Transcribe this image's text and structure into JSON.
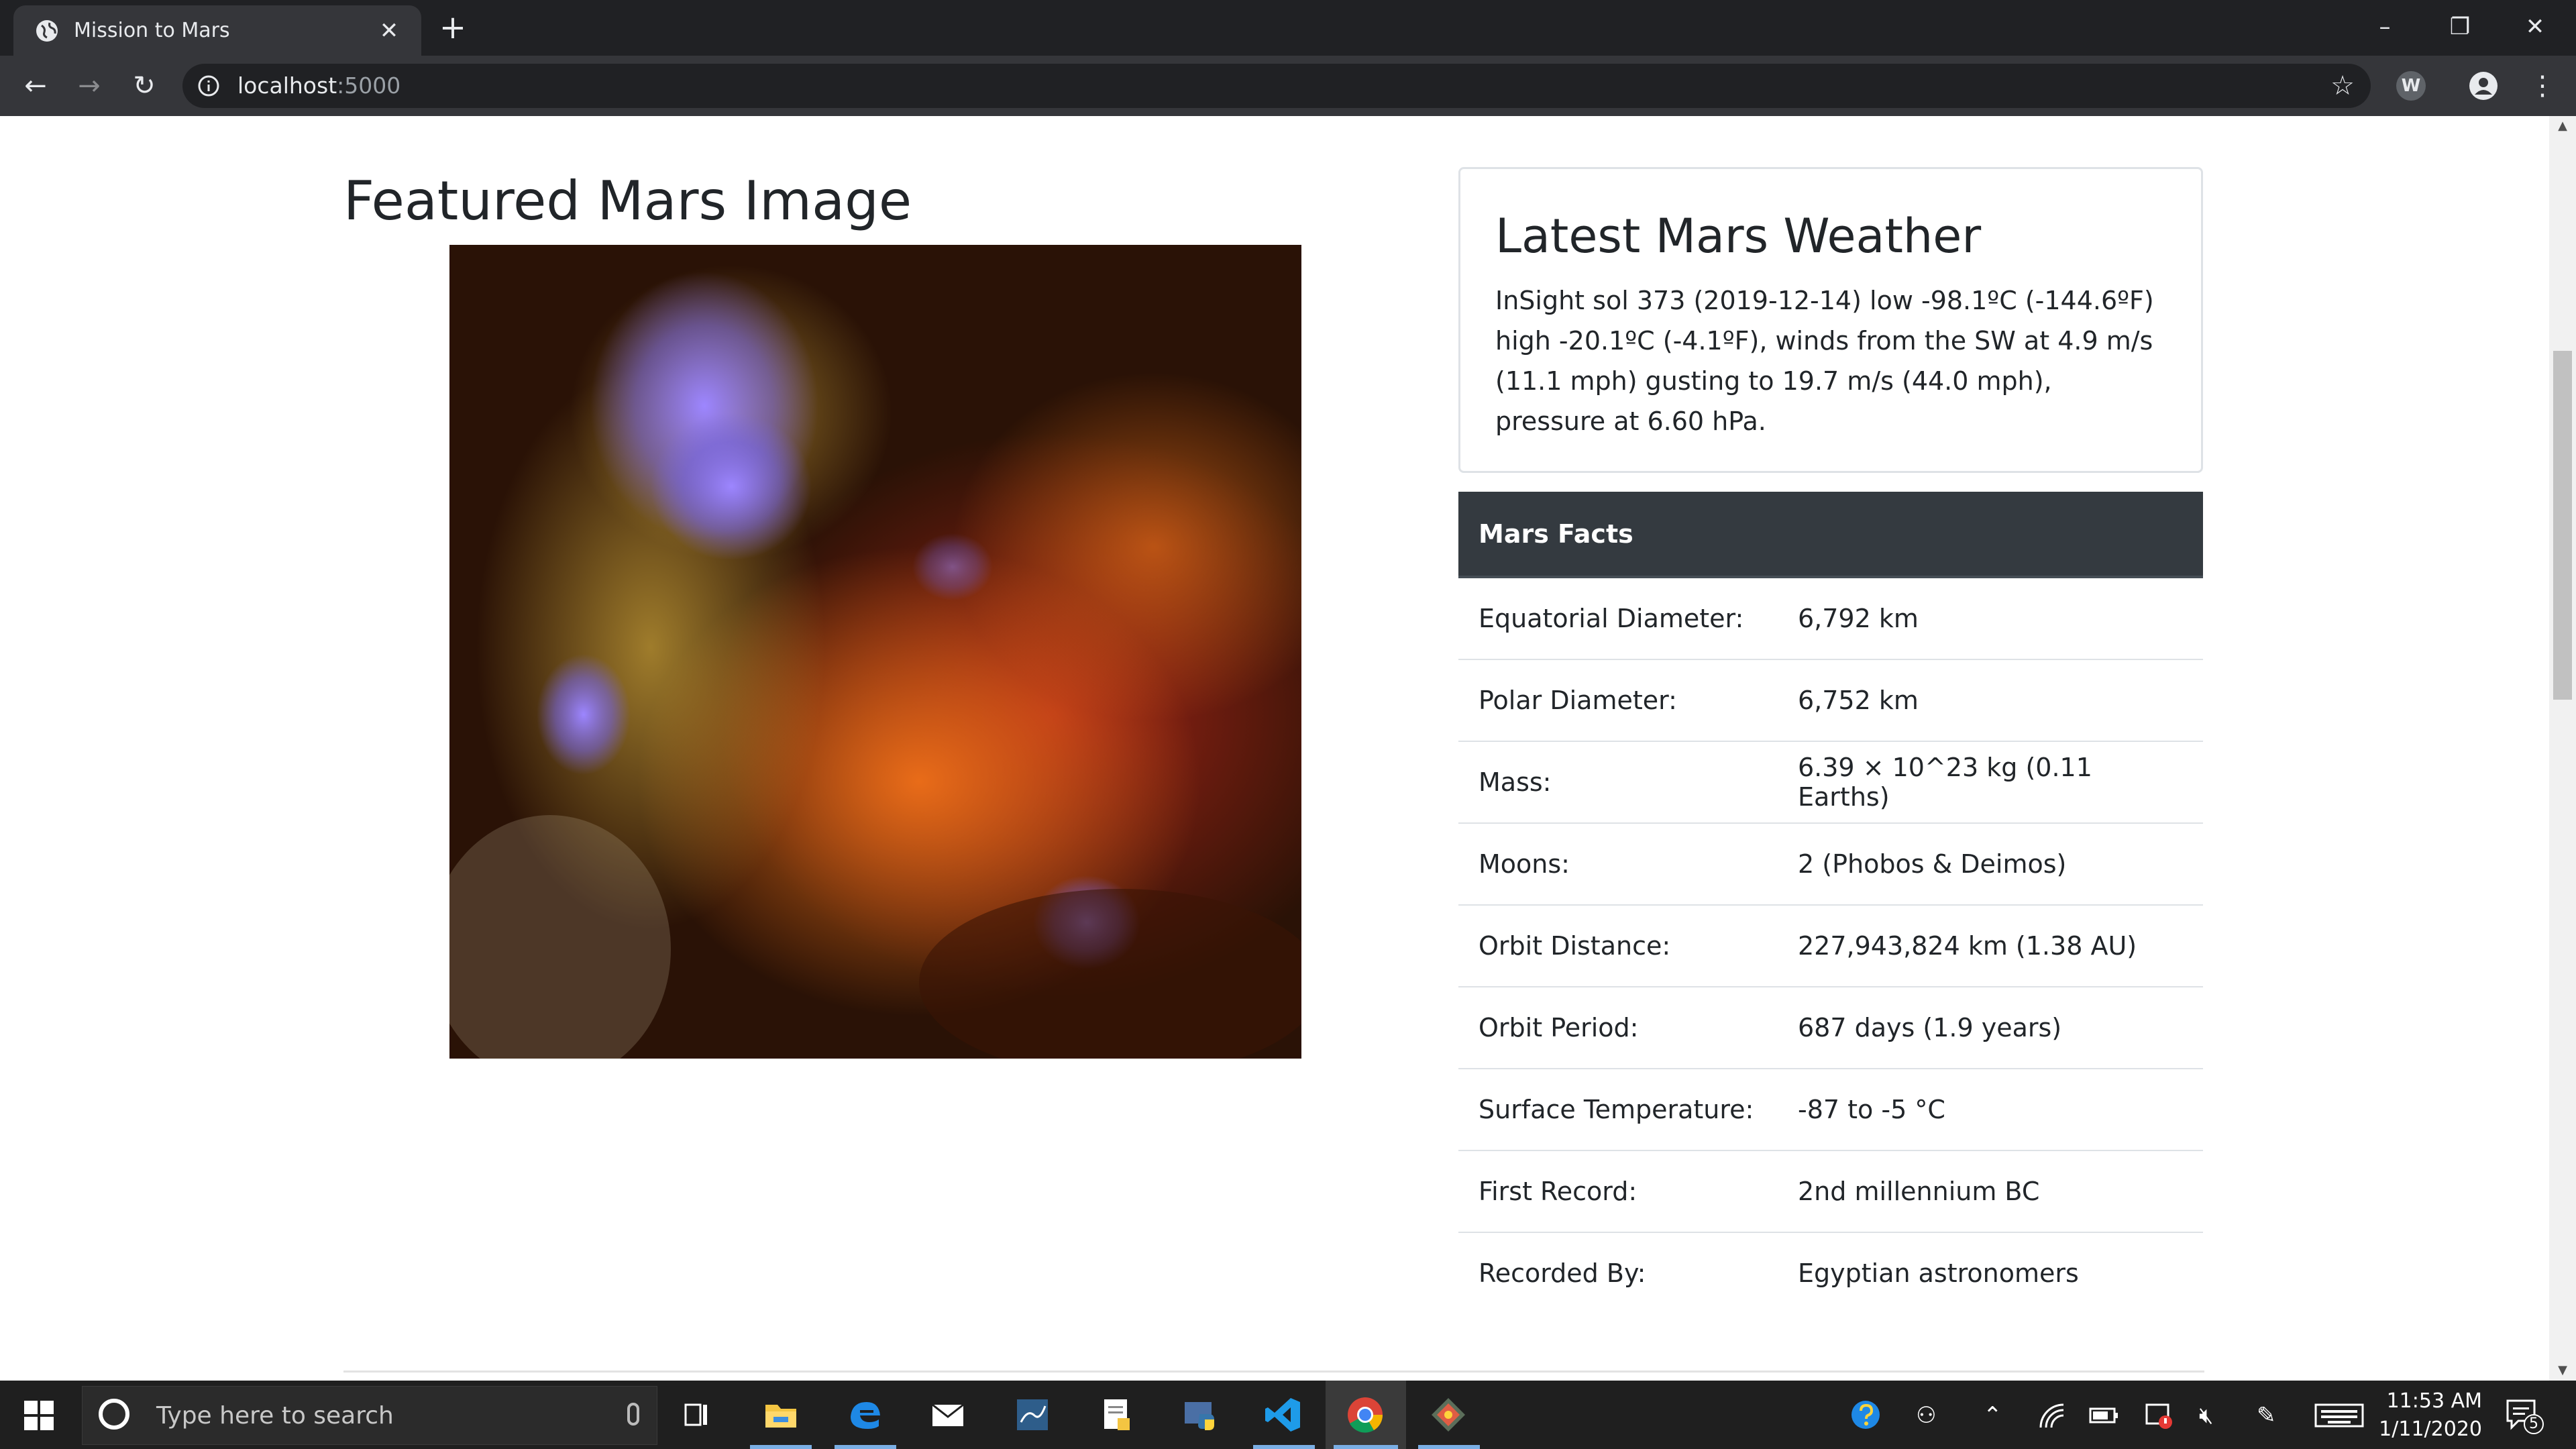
{
  "browser": {
    "tab_title": "Mission to Mars",
    "new_tab_label": "+",
    "url_host": "localhost",
    "url_port": ":5000",
    "extension_badge": "W"
  },
  "page": {
    "featured_heading": "Featured Mars Image",
    "weather_title": "Latest Mars Weather",
    "weather_text": "InSight sol 373 (2019-12-14) low -98.1ºC (-144.6ºF) high -20.1ºC (-4.1ºF), winds from the SW at 4.9 m/s (11.1 mph) gusting to 19.7 m/s (44.0 mph), pressure at 6.60 hPa.",
    "facts_header": "Mars Facts",
    "facts": [
      {
        "label": "Equatorial Diameter:",
        "value": "6,792 km"
      },
      {
        "label": "Polar Diameter:",
        "value": "6,752 km"
      },
      {
        "label": "Mass:",
        "value": "6.39 × 10^23 kg (0.11 Earths)"
      },
      {
        "label": "Moons:",
        "value": "2 (Phobos & Deimos)"
      },
      {
        "label": "Orbit Distance:",
        "value": "227,943,824 km (1.38 AU)"
      },
      {
        "label": "Orbit Period:",
        "value": "687 days (1.9 years)"
      },
      {
        "label": "Surface Temperature:",
        "value": "-87 to -5 °C"
      },
      {
        "label": "First Record:",
        "value": "2nd millennium BC"
      },
      {
        "label": "Recorded By:",
        "value": "Egyptian astronomers"
      }
    ]
  },
  "taskbar": {
    "search_placeholder": "Type here to search",
    "time": "11:53 AM",
    "date": "1/11/2020",
    "notification_count": "5"
  },
  "colors": {
    "tabstrip": "#202124",
    "toolbar": "#35363a",
    "table_header": "#343a40",
    "taskbar": "#1f1f1f"
  }
}
